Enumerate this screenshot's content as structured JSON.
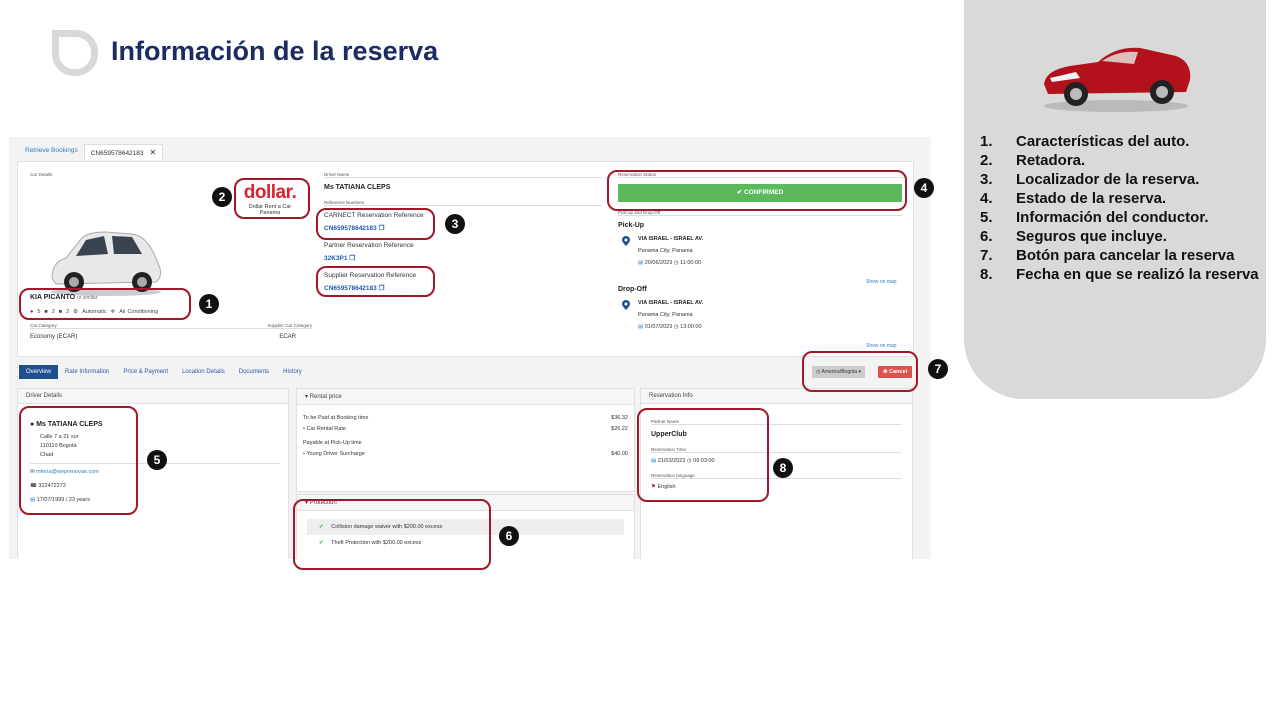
{
  "slide": {
    "title": "Información de la reserva",
    "legend": [
      {
        "num": "1.",
        "text": "Características del auto."
      },
      {
        "num": "2.",
        "text": "Retadora."
      },
      {
        "num": "3.",
        "text": "Localizador de la reserva."
      },
      {
        "num": "4.",
        "text": "Estado de la reserva."
      },
      {
        "num": "5.",
        "text": "Información del conductor."
      },
      {
        "num": "6.",
        "text": "Seguros que incluye."
      },
      {
        "num": "7.",
        "text": "Botón para cancelar la reserva"
      },
      {
        "num": "8.",
        "text": "Fecha en que se realizó la reserva"
      }
    ],
    "badges": [
      "1",
      "2",
      "3",
      "4",
      "5",
      "6",
      "7",
      "8"
    ]
  },
  "screenshot": {
    "tabs": {
      "retrieve": "Retrieve Bookings",
      "active": "CN659578642183",
      "close": "✕"
    },
    "car": {
      "section_label": "Car Details",
      "model": "KIA PICANTO",
      "similar": "or similar",
      "seats": "5",
      "bags_large": "2",
      "bags_small": "2",
      "transmission": "Automatic",
      "ac": "Air Conditioning",
      "category_label": "Car Category",
      "category_value": "Economy (ECAR)",
      "supplier_category_label": "Supplier Car Category",
      "supplier_category_value": "ECAR"
    },
    "supplier": {
      "brand": "dollar.",
      "line1": "Dollar Rent a Car",
      "line2": "Panama"
    },
    "driver_header": {
      "label": "Driver Name",
      "name": "Ms TATIANA CLEPS",
      "ref_label": "Reference Numbers",
      "carnect_label": "CARNECT Reservation Reference",
      "carnect_value": "CN659578642183",
      "partner_label": "Partner Reservation Reference",
      "partner_value": "32K3P1",
      "supplier_label": "Supplier Reservation Reference",
      "supplier_value": "CN659578642183"
    },
    "status": {
      "label": "Reservation Status",
      "value": "CONFIRMED",
      "pickdrop_label": "Pick-up and Drop-Off",
      "pickup_title": "Pick-Up",
      "pickup_place": "VIA ISRAEL - ISRAEL AV.",
      "pickup_city": "Panama City, Panama",
      "pickup_date": "20/06/2023",
      "pickup_time": "11:00:00",
      "show_map": "Show on map",
      "dropoff_title": "Drop-Off",
      "dropoff_place": "VIA ISRAEL - ISRAEL AV.",
      "dropoff_city": "Panama City, Panama",
      "dropoff_date": "01/07/2023",
      "dropoff_time": "13:00:00"
    },
    "nav": [
      "Overview",
      "Rate Information",
      "Price & Payment",
      "Location Details",
      "Documents",
      "History"
    ],
    "actions": {
      "timezone": "America/Bogota",
      "cancel": "Cancel"
    },
    "driver_details": {
      "title": "Driver Details",
      "name": "Ms TATIANA CLEPS",
      "addr1": "Calle 7 a 21 sur",
      "addr2": "110110 Bogotá",
      "addr3": "Chad",
      "email": "mferia@weprenovae.com",
      "phone": "322472272",
      "dob": "17/07/1999 / 23 years"
    },
    "rental_price": {
      "title": "Rental price",
      "booking_label": "To be Paid at Booking time",
      "booking_total": "$36.32",
      "car_rental_label": "Car Rental Rate",
      "car_rental_value": "$26.22",
      "pickup_label": "Payable at Pick-Up time",
      "young_label": "Young Driver Surcharge",
      "young_value": "$40.00"
    },
    "protection": {
      "title": "Protection",
      "items": [
        "Collision damage waiver with $200.00 excess",
        "Theft Protection with $200.00 excess"
      ]
    },
    "reservation_info": {
      "title": "Reservation Info",
      "partner_label": "Partner Name",
      "partner_value": "UpperClub",
      "time_label": "Reservation Time",
      "time_value": "21/03/2023",
      "time_clock": "09:03:00",
      "lang_label": "Reservation language",
      "lang_value": "English"
    }
  }
}
